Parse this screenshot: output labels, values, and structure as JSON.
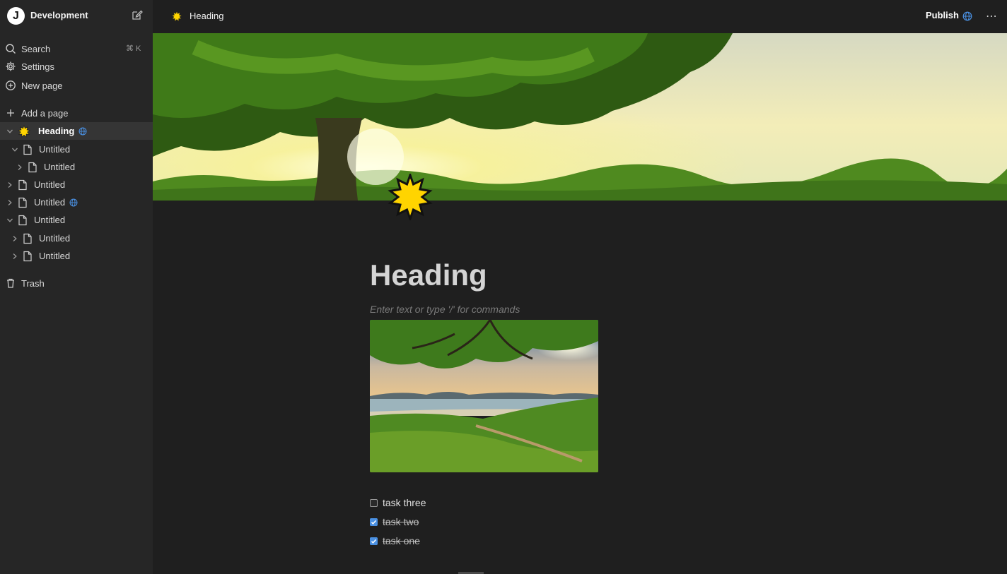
{
  "workspace": {
    "logo_letter": "J",
    "name": "Development"
  },
  "nav": {
    "search": "Search",
    "search_shortcut": "⌘ K",
    "settings": "Settings",
    "new_page": "New page",
    "add_page": "Add a page",
    "trash": "Trash"
  },
  "tree": [
    {
      "label": "Heading",
      "level": 0,
      "expanded": true,
      "icon": "sun-emoji-icon",
      "published": true,
      "active": true
    },
    {
      "label": "Untitled",
      "level": 1,
      "expanded": true,
      "icon": "page-icon"
    },
    {
      "label": "Untitled",
      "level": 2,
      "expanded": false,
      "icon": "page-icon"
    },
    {
      "label": "Untitled",
      "level": 0,
      "expanded": false,
      "icon": "page-icon"
    },
    {
      "label": "Untitled",
      "level": 0,
      "expanded": false,
      "icon": "page-icon",
      "published": true
    },
    {
      "label": "Untitled",
      "level": 0,
      "expanded": true,
      "icon": "page-icon"
    },
    {
      "label": "Untitled",
      "level": 1,
      "expanded": false,
      "icon": "page-icon"
    },
    {
      "label": "Untitled",
      "level": 1,
      "expanded": false,
      "icon": "page-icon"
    }
  ],
  "topbar": {
    "breadcrumb": "Heading",
    "publish": "Publish",
    "more": "⋯"
  },
  "page": {
    "title": "Heading",
    "placeholder": "Enter text or type '/' for commands",
    "todos": [
      {
        "text": "task three",
        "checked": false
      },
      {
        "text": "task two",
        "checked": true
      },
      {
        "text": "task one",
        "checked": true
      }
    ]
  },
  "colors": {
    "accent": "#4a90e2",
    "sidebar_bg": "#262626",
    "page_bg": "#1f1f1f",
    "sun": "#ffd400"
  }
}
